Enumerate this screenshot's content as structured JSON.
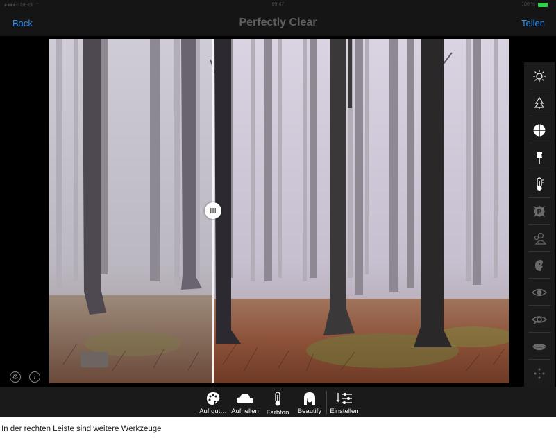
{
  "status": {
    "carrier": "●●●●○ DE-dk ⌔",
    "time": "09:47",
    "battery": "100 %"
  },
  "nav": {
    "back": "Back",
    "title": "Perfectly Clear",
    "share": "Teilen"
  },
  "corner": {
    "settings_glyph": "⚙",
    "info_glyph": "i"
  },
  "sidebar": {
    "items": [
      {
        "icon": "sun-icon",
        "color": "#e6e6e6"
      },
      {
        "icon": "tree-sharpen-icon",
        "color": "#e6e6e6"
      },
      {
        "icon": "contrast-circle-icon",
        "color": "#ffffff"
      },
      {
        "icon": "pin-icon",
        "color": "#ffffff"
      },
      {
        "icon": "thermometer-icon",
        "color": "#ffffff"
      },
      {
        "icon": "p-badge-icon",
        "color": "#6a6a6a"
      },
      {
        "icon": "people-icon",
        "color": "#6a6a6a"
      },
      {
        "icon": "face-profile-icon",
        "color": "#6a6a6a"
      },
      {
        "icon": "eye-icon",
        "color": "#6a6a6a"
      },
      {
        "icon": "eye-enhance-icon",
        "color": "#6a6a6a"
      },
      {
        "icon": "lips-icon",
        "color": "#6a6a6a"
      },
      {
        "icon": "sparkle-dots-icon",
        "color": "#6a6a6a"
      }
    ]
  },
  "toolbar": {
    "tools": [
      {
        "label": "Auf gut…",
        "icon": "palette-icon"
      },
      {
        "label": "Aufhellen",
        "icon": "cloud-icon"
      },
      {
        "label": "Farbton",
        "icon": "thermometer-icon"
      },
      {
        "label": "Beautify",
        "icon": "face-icon"
      },
      {
        "label": "Einstellen",
        "icon": "sliders-icon"
      }
    ]
  },
  "caption": "In der rechten Leiste sind weitere Werkzeuge",
  "colors": {
    "accent": "#2d8cf0",
    "battery": "#2fd34a"
  }
}
